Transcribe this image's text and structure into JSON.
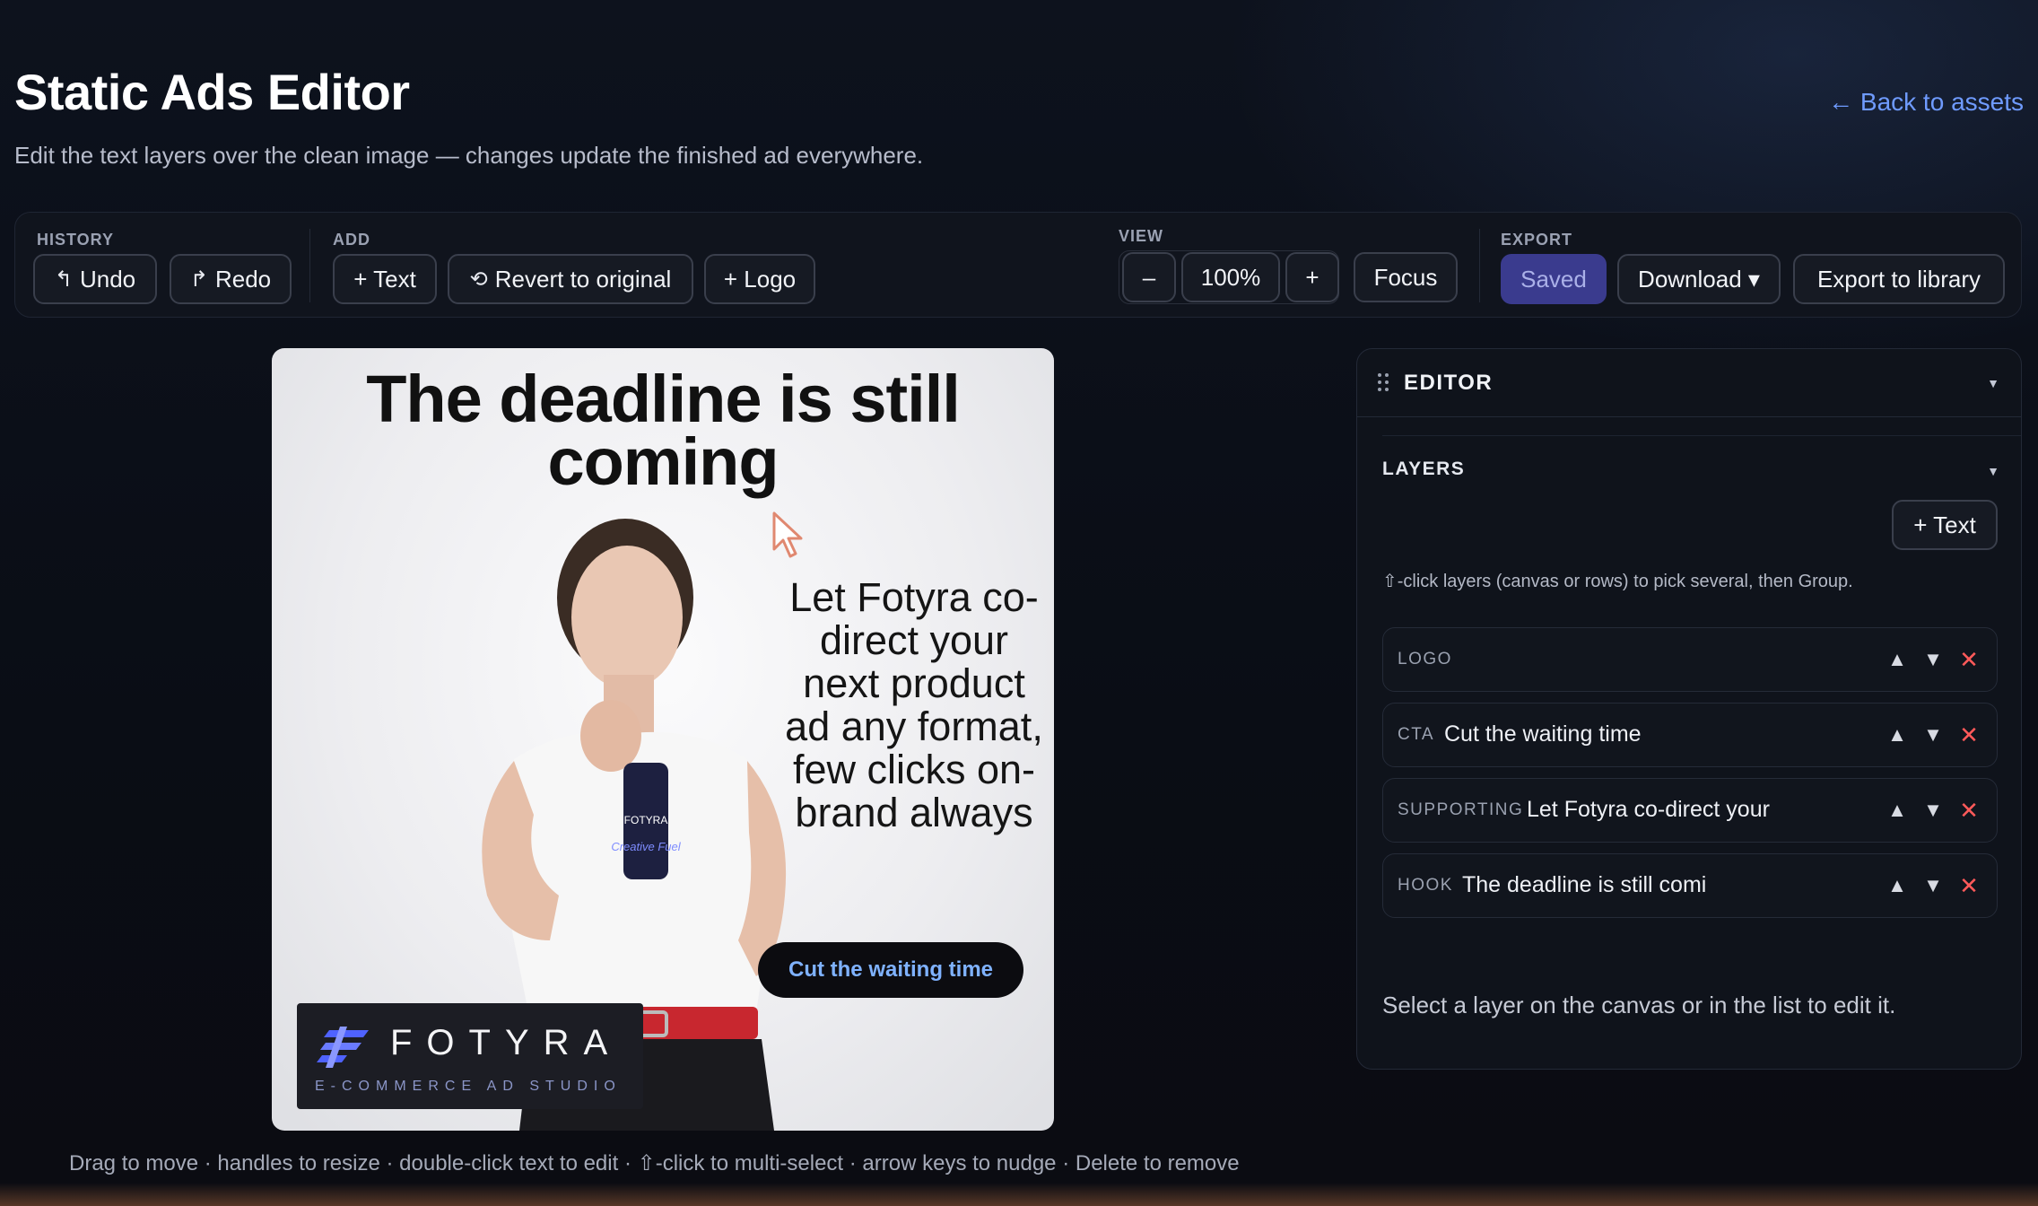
{
  "header": {
    "title": "Static Ads Editor",
    "subtitle": "Edit the text layers over the clean image — changes update the finished ad everywhere.",
    "back_link": "← Back to assets"
  },
  "toolbar": {
    "history": {
      "label": "HISTORY",
      "undo": "Undo",
      "redo": "Redo"
    },
    "add": {
      "label": "ADD",
      "text": "+ Text",
      "revert": "Revert to original",
      "logo": "+ Logo"
    },
    "view": {
      "label": "VIEW",
      "zoom_out": "–",
      "zoom": "100%",
      "zoom_in": "+",
      "focus": "Focus"
    },
    "export": {
      "label": "EXPORT",
      "saved": "Saved",
      "download": "Download ▾",
      "export_library": "Export to library"
    }
  },
  "ad": {
    "hook": "The deadline is still coming",
    "supporting": "Let Fotyra co-direct your next product ad any format, few clicks on-brand always",
    "cta": "Cut the waiting time",
    "logo_word": "FOTYRA",
    "logo_tagline": "E-COMMERCE AD STUDIO",
    "can_brand": "FOTYRA",
    "can_text": "Creative Fuel"
  },
  "editor": {
    "title": "EDITOR",
    "layers_title": "LAYERS",
    "add_text": "+ Text",
    "hint": "⇧-click layers (canvas or rows) to pick several, then Group.",
    "layers": [
      {
        "kind": "LOGO",
        "text": ""
      },
      {
        "kind": "CTA",
        "text": "Cut the waiting time"
      },
      {
        "kind": "SUPPORTING",
        "text": "Let Fotyra co-direct your"
      },
      {
        "kind": "HOOK",
        "text": "The deadline is still comi"
      }
    ],
    "select_message": "Select a layer on the canvas or in the list to edit it."
  },
  "footer_hint": "Drag to move · handles to resize · double-click text to edit · ⇧-click to multi-select · arrow keys to nudge · Delete to remove",
  "colors": {
    "accent": "#6f9bff",
    "saved_button": "#3a3b8e",
    "delete": "#ff5a5a",
    "cta_text": "#7fb2ff"
  }
}
